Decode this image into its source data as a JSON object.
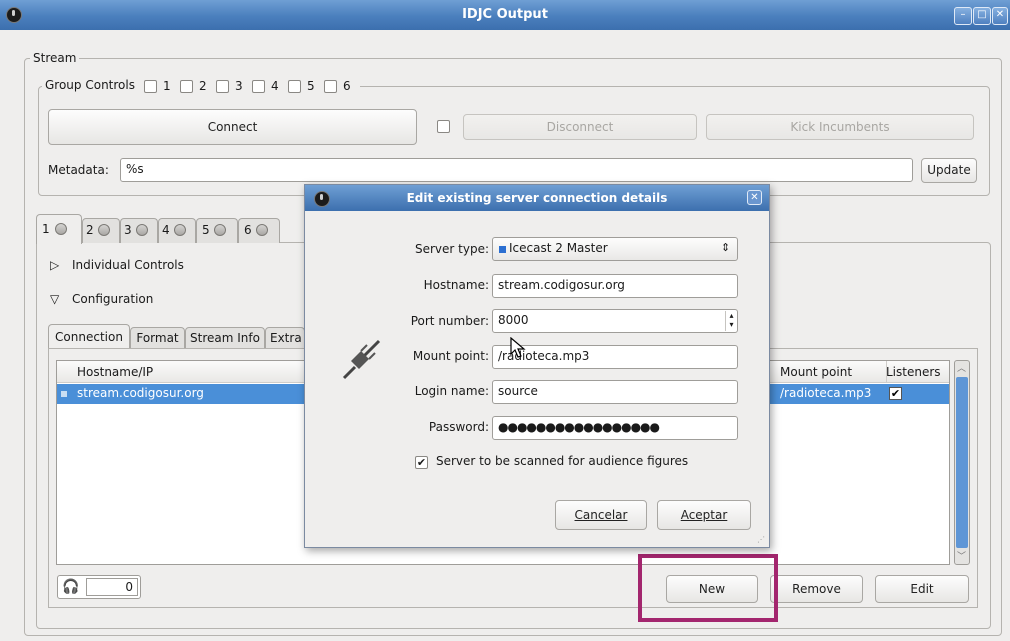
{
  "window": {
    "title": "IDJC Output"
  },
  "stream": {
    "frame_label": "Stream",
    "group_controls": {
      "label": "Group Controls",
      "items": [
        "1",
        "2",
        "3",
        "4",
        "5",
        "6"
      ]
    },
    "connect_label": "Connect",
    "disconnect_label": "Disconnect",
    "kick_label": "Kick Incumbents",
    "metadata_label": "Metadata:",
    "metadata_value": "%s",
    "update_label": "Update"
  },
  "tabs": [
    "1",
    "2",
    "3",
    "4",
    "5",
    "6"
  ],
  "panel": {
    "individual_controls": "Individual Controls",
    "configuration": "Configuration",
    "subtabs": [
      "Connection",
      "Format",
      "Stream Info",
      "Extra"
    ],
    "columns": {
      "hostname": "Hostname/IP",
      "mount": "Mount point",
      "listeners": "Listeners"
    },
    "row": {
      "hostname": "stream.codigosur.org",
      "mount": "/radioteca.mp3"
    },
    "listener_count": "0",
    "new_label": "New",
    "remove_label": "Remove",
    "edit_label": "Edit"
  },
  "dialog": {
    "title": "Edit existing server connection details",
    "server_type_label": "Server type:",
    "server_type_value": "Icecast 2 Master",
    "hostname_label": "Hostname:",
    "hostname_value": "stream.codigosur.org",
    "port_label": "Port number:",
    "port_value": "8000",
    "mount_label": "Mount point:",
    "mount_value": "/radioteca.mp3",
    "login_label": "Login name:",
    "login_value": "source",
    "password_label": "Password:",
    "password_value": "●●●●●●●●●●●●●●●●●",
    "scan_label": "Server to be scanned for audience figures",
    "cancel_label": "Cancelar",
    "accept_label": "Aceptar"
  },
  "colors": {
    "highlight": "#a3266e",
    "selection": "#4a8fd8",
    "titlebar": "#4a7fbd"
  }
}
